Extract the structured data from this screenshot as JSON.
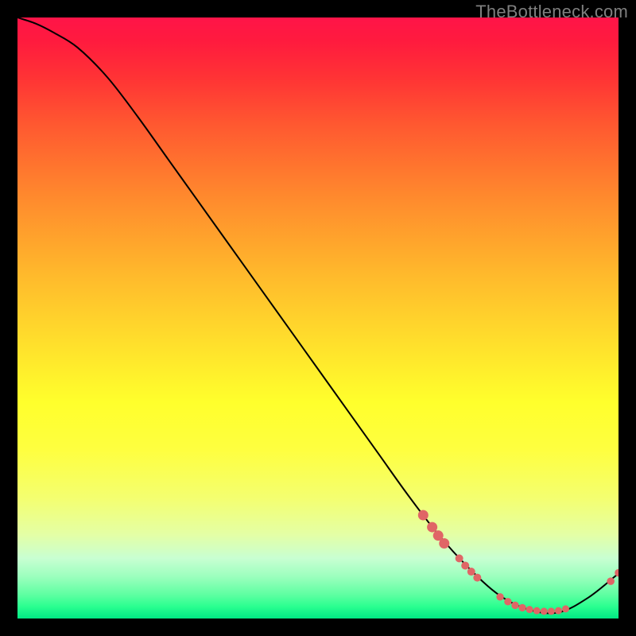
{
  "watermark": "TheBottleneck.com",
  "chart_data": {
    "type": "line",
    "title": "",
    "xlabel": "",
    "ylabel": "",
    "xlim": [
      0,
      100
    ],
    "ylim": [
      0,
      100
    ],
    "grid": false,
    "legend": false,
    "series": [
      {
        "name": "curve",
        "color": "#000000",
        "x": [
          0,
          3,
          6,
          10,
          15,
          20,
          25,
          30,
          35,
          40,
          45,
          50,
          55,
          60,
          65,
          70,
          75,
          80,
          85,
          90,
          95,
          100
        ],
        "y": [
          100,
          99,
          97.5,
          95,
          90,
          83.5,
          76.5,
          69.5,
          62.5,
          55.5,
          48.5,
          41.5,
          34.5,
          27.5,
          20.5,
          14,
          8.5,
          4,
          1.5,
          1,
          3.5,
          7.5
        ]
      }
    ],
    "markers": [
      {
        "x": 67.5,
        "y": 17.2,
        "r": 6.5,
        "color": "#e06666"
      },
      {
        "x": 69.0,
        "y": 15.2,
        "r": 6.5,
        "color": "#e06666"
      },
      {
        "x": 70.0,
        "y": 13.8,
        "r": 6.5,
        "color": "#e06666"
      },
      {
        "x": 71.0,
        "y": 12.5,
        "r": 6.5,
        "color": "#e06666"
      },
      {
        "x": 73.5,
        "y": 10.0,
        "r": 5.0,
        "color": "#e06666"
      },
      {
        "x": 74.5,
        "y": 8.8,
        "r": 5.0,
        "color": "#e06666"
      },
      {
        "x": 75.5,
        "y": 7.8,
        "r": 5.0,
        "color": "#e06666"
      },
      {
        "x": 76.5,
        "y": 6.8,
        "r": 5.0,
        "color": "#e06666"
      },
      {
        "x": 80.3,
        "y": 3.6,
        "r": 4.7,
        "color": "#e06666"
      },
      {
        "x": 81.6,
        "y": 2.8,
        "r": 4.7,
        "color": "#e06666"
      },
      {
        "x": 82.8,
        "y": 2.2,
        "r": 4.7,
        "color": "#e06666"
      },
      {
        "x": 84.0,
        "y": 1.8,
        "r": 4.7,
        "color": "#e06666"
      },
      {
        "x": 85.2,
        "y": 1.5,
        "r": 4.5,
        "color": "#e06666"
      },
      {
        "x": 86.4,
        "y": 1.3,
        "r": 4.5,
        "color": "#e06666"
      },
      {
        "x": 87.6,
        "y": 1.2,
        "r": 4.5,
        "color": "#e06666"
      },
      {
        "x": 88.8,
        "y": 1.2,
        "r": 4.5,
        "color": "#e06666"
      },
      {
        "x": 90.0,
        "y": 1.3,
        "r": 4.5,
        "color": "#e06666"
      },
      {
        "x": 91.2,
        "y": 1.6,
        "r": 4.5,
        "color": "#e06666"
      },
      {
        "x": 98.7,
        "y": 6.2,
        "r": 4.8,
        "color": "#e06666"
      },
      {
        "x": 100.0,
        "y": 7.6,
        "r": 4.8,
        "color": "#e06666"
      }
    ]
  }
}
